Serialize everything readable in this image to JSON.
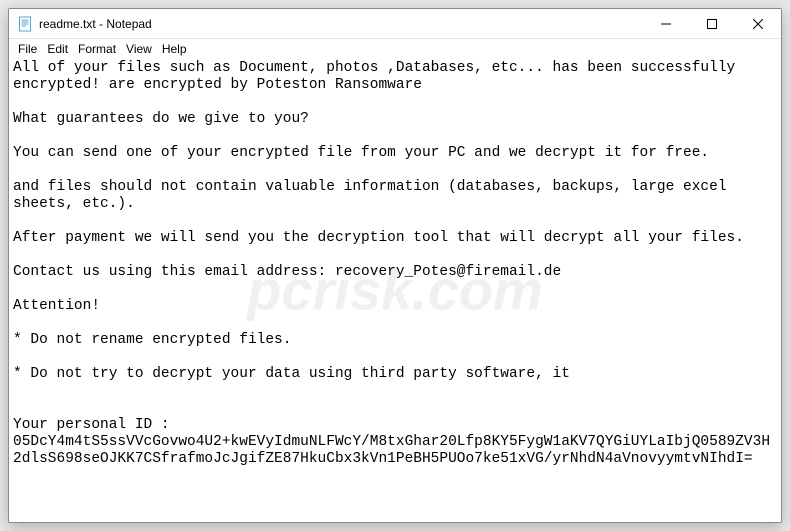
{
  "titlebar": {
    "title": "readme.txt - Notepad"
  },
  "menubar": {
    "items": [
      "File",
      "Edit",
      "Format",
      "View",
      "Help"
    ]
  },
  "content": {
    "text": "All of your files such as Document, photos ,Databases, etc... has been successfully encrypted! are encrypted by Poteston Ransomware\n\nWhat guarantees do we give to you?\n\nYou can send one of your encrypted file from your PC and we decrypt it for free.\n\nand files should not contain valuable information (databases, backups, large excel sheets, etc.).\n\nAfter payment we will send you the decryption tool that will decrypt all your files.\n\nContact us using this email address: recovery_Potes@firemail.de\n\nAttention!\n\n* Do not rename encrypted files.\n\n* Do not try to decrypt your data using third party software, it\n\n\nYour personal ID :\n05DcY4m4tS5ssVVcGovwo4U2+kwEVyIdmuNLFWcY/M8txGhar20Lfp8KY5FygW1aKV7QYGiUYLaIbjQ0589ZV3H2dlsS698seOJKK7CSfrafmoJcJgifZE87HkuCbx3kVn1PeBH5PUOo7ke51xVG/yrNhdN4aVnovyymtvNIhdI="
  },
  "watermark": "pcrisk.com"
}
